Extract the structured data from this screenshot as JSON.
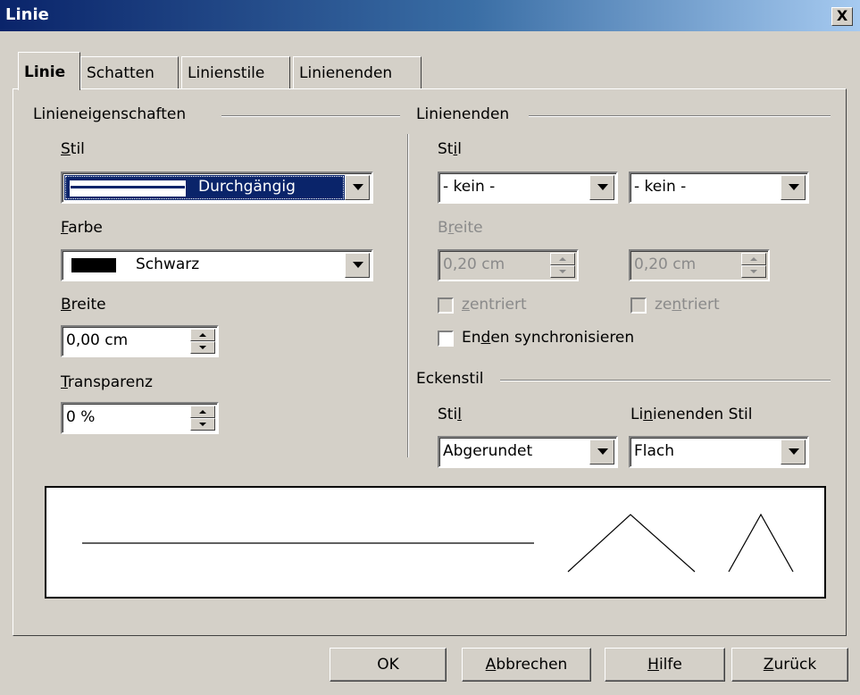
{
  "window": {
    "title": "Linie",
    "close_label": "X"
  },
  "tabs": [
    {
      "label": "Linie",
      "active": true
    },
    {
      "label": "Schatten",
      "active": false
    },
    {
      "label": "Linienstile",
      "active": false
    },
    {
      "label": "Linienenden",
      "active": false
    }
  ],
  "line_props": {
    "group_label": "Linieneigenschaften",
    "style": {
      "label_pre": "",
      "label_u": "S",
      "label_post": "til",
      "value": "Durchgängig"
    },
    "color": {
      "label_pre": "",
      "label_u": "F",
      "label_post": "arbe",
      "value": "Schwarz",
      "swatch": "#000000"
    },
    "width": {
      "label_pre": "",
      "label_u": "B",
      "label_post": "reite",
      "value": "0,00 cm"
    },
    "transparency": {
      "label_pre": "",
      "label_u": "T",
      "label_post": "ransparenz",
      "value": "0 %"
    }
  },
  "line_ends": {
    "group_label": "Linienenden",
    "style": {
      "label_pre": "St",
      "label_u": "i",
      "label_post": "l",
      "start_value": "- kein -",
      "end_value": "- kein -"
    },
    "width": {
      "label_pre": "B",
      "label_u": "r",
      "label_post": "eite",
      "start_value": "0,20 cm",
      "end_value": "0,20 cm"
    },
    "centered_start": {
      "label_pre": "",
      "label_u": "z",
      "label_post": "entriert"
    },
    "centered_end": {
      "label_pre": "ze",
      "label_u": "n",
      "label_post": "triert"
    },
    "sync": {
      "label_pre": "En",
      "label_u": "d",
      "label_post": "en synchronisieren"
    }
  },
  "corner": {
    "group_label": "Eckenstil",
    "style": {
      "label_pre": "Sti",
      "label_u": "l",
      "label_post": "",
      "value": "Abgerundet"
    },
    "cap": {
      "label_pre": "Li",
      "label_u": "n",
      "label_post": "ienenden Stil",
      "value": "Flach"
    }
  },
  "buttons": {
    "ok": {
      "pre": "OK",
      "u": "",
      "post": ""
    },
    "cancel": {
      "pre": "",
      "u": "A",
      "post": "bbrechen"
    },
    "help": {
      "pre": "",
      "u": "H",
      "post": "ilfe"
    },
    "back": {
      "pre": "",
      "u": "Z",
      "post": "urück"
    }
  },
  "colors": {
    "titlebar_start": "#0a246a",
    "titlebar_end": "#a6caf0",
    "selection": "#0a246a",
    "face": "#d4d0c8"
  }
}
